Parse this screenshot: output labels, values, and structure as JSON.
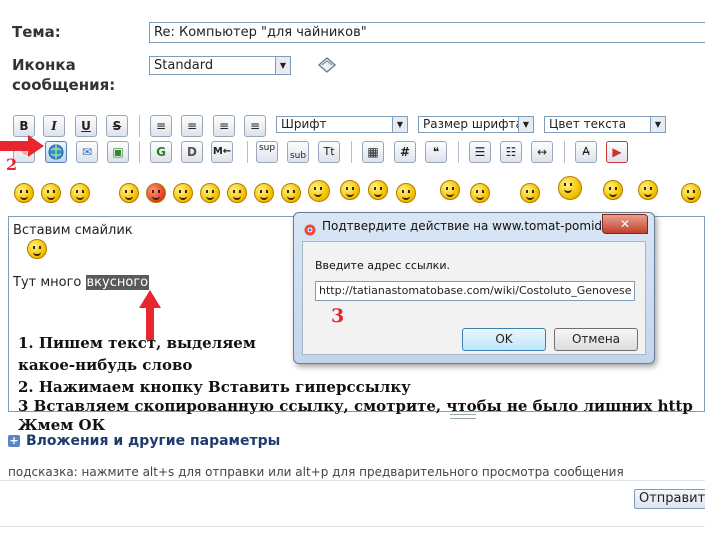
{
  "form": {
    "subject_label": "Тема:",
    "subject_value": "Re: Компьютер \"для чайников\"",
    "icon_label_line1": "Иконка",
    "icon_label_line2": "сообщения:",
    "icon_value": "Standard"
  },
  "toolbar": {
    "font_select": "Шрифт",
    "size_select": "Размер шрифта",
    "color_select": "Цвет текста",
    "bold": "B",
    "italic": "I",
    "underline": "U",
    "strike": "S",
    "sup": "sup",
    "sub": "sub",
    "tt": "Tt",
    "hash": "#"
  },
  "editor": {
    "line1": "Вставим смайлик",
    "line2_prefix": "Тут много ",
    "line2_selected": "вкусного"
  },
  "instructions": {
    "step1a": "1. Пишем текст, выделяем",
    "step1b": "какое-нибудь слово",
    "step2": "2. Нажимаем кнопку Вставить гиперссылку",
    "step3": "3 Вставляем скопированную ссылку, смотрите, чтобы не было лишних http",
    "step4": "Жмем ОК"
  },
  "markers": {
    "two": "2",
    "three": "3"
  },
  "dialog": {
    "title": "Подтвердите действие на www.tomat-pomidor.c...",
    "close": "✕",
    "prompt": "Введите адрес ссылки.",
    "url_value": "http://tatianastomatobase.com/wiki/Costoluto_Genovese",
    "ok": "OK",
    "cancel": "Отмена"
  },
  "attachments_link": "Вложения и другие параметры",
  "hint": "подсказка: нажмите alt+s для отправки или alt+p для предварительного просмотра сообщения",
  "submit_button": "Отправить",
  "colors": {
    "arrow": "#e8262d",
    "link": "#1f3c6e",
    "selection": "#5a5a5a"
  }
}
